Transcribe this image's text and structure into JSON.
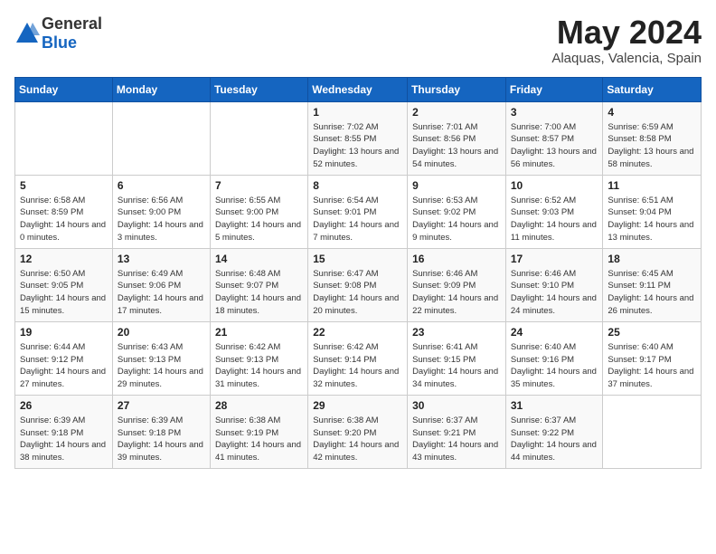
{
  "header": {
    "logo_general": "General",
    "logo_blue": "Blue",
    "month": "May 2024",
    "location": "Alaquas, Valencia, Spain"
  },
  "weekdays": [
    "Sunday",
    "Monday",
    "Tuesday",
    "Wednesday",
    "Thursday",
    "Friday",
    "Saturday"
  ],
  "weeks": [
    [
      {
        "day": "",
        "info": ""
      },
      {
        "day": "",
        "info": ""
      },
      {
        "day": "",
        "info": ""
      },
      {
        "day": "1",
        "info": "Sunrise: 7:02 AM\nSunset: 8:55 PM\nDaylight: 13 hours and 52 minutes."
      },
      {
        "day": "2",
        "info": "Sunrise: 7:01 AM\nSunset: 8:56 PM\nDaylight: 13 hours and 54 minutes."
      },
      {
        "day": "3",
        "info": "Sunrise: 7:00 AM\nSunset: 8:57 PM\nDaylight: 13 hours and 56 minutes."
      },
      {
        "day": "4",
        "info": "Sunrise: 6:59 AM\nSunset: 8:58 PM\nDaylight: 13 hours and 58 minutes."
      }
    ],
    [
      {
        "day": "5",
        "info": "Sunrise: 6:58 AM\nSunset: 8:59 PM\nDaylight: 14 hours and 0 minutes."
      },
      {
        "day": "6",
        "info": "Sunrise: 6:56 AM\nSunset: 9:00 PM\nDaylight: 14 hours and 3 minutes."
      },
      {
        "day": "7",
        "info": "Sunrise: 6:55 AM\nSunset: 9:00 PM\nDaylight: 14 hours and 5 minutes."
      },
      {
        "day": "8",
        "info": "Sunrise: 6:54 AM\nSunset: 9:01 PM\nDaylight: 14 hours and 7 minutes."
      },
      {
        "day": "9",
        "info": "Sunrise: 6:53 AM\nSunset: 9:02 PM\nDaylight: 14 hours and 9 minutes."
      },
      {
        "day": "10",
        "info": "Sunrise: 6:52 AM\nSunset: 9:03 PM\nDaylight: 14 hours and 11 minutes."
      },
      {
        "day": "11",
        "info": "Sunrise: 6:51 AM\nSunset: 9:04 PM\nDaylight: 14 hours and 13 minutes."
      }
    ],
    [
      {
        "day": "12",
        "info": "Sunrise: 6:50 AM\nSunset: 9:05 PM\nDaylight: 14 hours and 15 minutes."
      },
      {
        "day": "13",
        "info": "Sunrise: 6:49 AM\nSunset: 9:06 PM\nDaylight: 14 hours and 17 minutes."
      },
      {
        "day": "14",
        "info": "Sunrise: 6:48 AM\nSunset: 9:07 PM\nDaylight: 14 hours and 18 minutes."
      },
      {
        "day": "15",
        "info": "Sunrise: 6:47 AM\nSunset: 9:08 PM\nDaylight: 14 hours and 20 minutes."
      },
      {
        "day": "16",
        "info": "Sunrise: 6:46 AM\nSunset: 9:09 PM\nDaylight: 14 hours and 22 minutes."
      },
      {
        "day": "17",
        "info": "Sunrise: 6:46 AM\nSunset: 9:10 PM\nDaylight: 14 hours and 24 minutes."
      },
      {
        "day": "18",
        "info": "Sunrise: 6:45 AM\nSunset: 9:11 PM\nDaylight: 14 hours and 26 minutes."
      }
    ],
    [
      {
        "day": "19",
        "info": "Sunrise: 6:44 AM\nSunset: 9:12 PM\nDaylight: 14 hours and 27 minutes."
      },
      {
        "day": "20",
        "info": "Sunrise: 6:43 AM\nSunset: 9:13 PM\nDaylight: 14 hours and 29 minutes."
      },
      {
        "day": "21",
        "info": "Sunrise: 6:42 AM\nSunset: 9:13 PM\nDaylight: 14 hours and 31 minutes."
      },
      {
        "day": "22",
        "info": "Sunrise: 6:42 AM\nSunset: 9:14 PM\nDaylight: 14 hours and 32 minutes."
      },
      {
        "day": "23",
        "info": "Sunrise: 6:41 AM\nSunset: 9:15 PM\nDaylight: 14 hours and 34 minutes."
      },
      {
        "day": "24",
        "info": "Sunrise: 6:40 AM\nSunset: 9:16 PM\nDaylight: 14 hours and 35 minutes."
      },
      {
        "day": "25",
        "info": "Sunrise: 6:40 AM\nSunset: 9:17 PM\nDaylight: 14 hours and 37 minutes."
      }
    ],
    [
      {
        "day": "26",
        "info": "Sunrise: 6:39 AM\nSunset: 9:18 PM\nDaylight: 14 hours and 38 minutes."
      },
      {
        "day": "27",
        "info": "Sunrise: 6:39 AM\nSunset: 9:18 PM\nDaylight: 14 hours and 39 minutes."
      },
      {
        "day": "28",
        "info": "Sunrise: 6:38 AM\nSunset: 9:19 PM\nDaylight: 14 hours and 41 minutes."
      },
      {
        "day": "29",
        "info": "Sunrise: 6:38 AM\nSunset: 9:20 PM\nDaylight: 14 hours and 42 minutes."
      },
      {
        "day": "30",
        "info": "Sunrise: 6:37 AM\nSunset: 9:21 PM\nDaylight: 14 hours and 43 minutes."
      },
      {
        "day": "31",
        "info": "Sunrise: 6:37 AM\nSunset: 9:22 PM\nDaylight: 14 hours and 44 minutes."
      },
      {
        "day": "",
        "info": ""
      }
    ]
  ]
}
